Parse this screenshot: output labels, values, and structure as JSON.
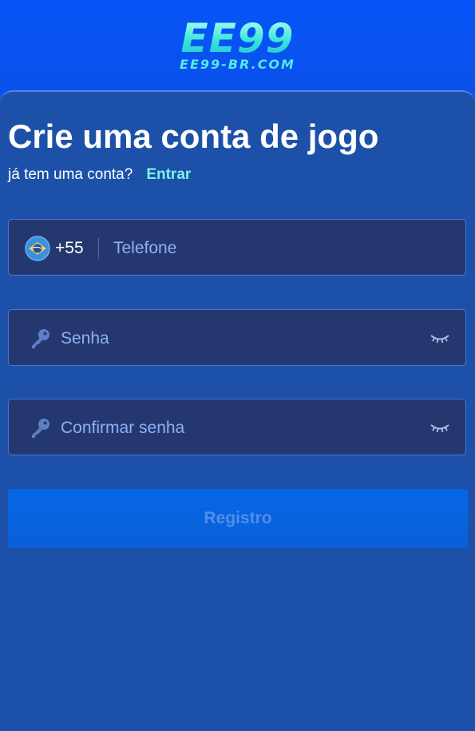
{
  "brand": {
    "logo": "EE99",
    "domain": "EE99-BR.COM"
  },
  "form": {
    "title": "Crie uma conta de jogo",
    "have_account": "já tem uma conta?",
    "login_link": "Entrar",
    "phone": {
      "country_code": "+55",
      "placeholder": "Telefone",
      "flag_icon": "brazil-flag-icon"
    },
    "password": {
      "placeholder": "Senha",
      "icon": "key-icon",
      "toggle_icon": "eye-closed-icon"
    },
    "confirm_password": {
      "placeholder": "Confirmar senha",
      "icon": "key-icon",
      "toggle_icon": "eye-closed-icon"
    },
    "submit_label": "Registro"
  },
  "colors": {
    "header_bg": "#0a55f2",
    "card_bg": "#1d51a9",
    "field_bg": "#24386f",
    "accent_link": "#7ff2ea",
    "button_bg": "#0566e6"
  }
}
